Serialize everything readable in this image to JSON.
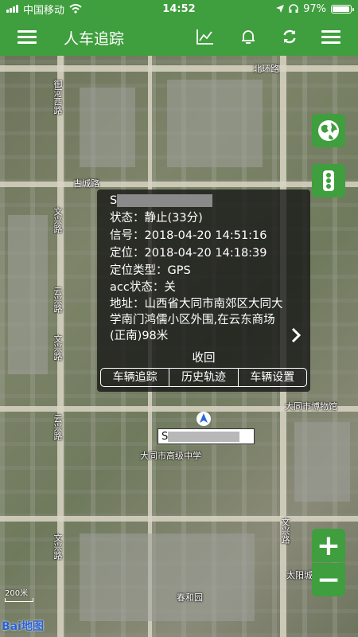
{
  "status_bar": {
    "carrier": "中国移动",
    "time": "14:52",
    "battery": "97%",
    "battery_level": 0.97
  },
  "nav": {
    "title": "人车追踪",
    "icons": [
      "menu-icon",
      "chart-icon",
      "bell-icon",
      "refresh-icon",
      "list-menu-icon"
    ]
  },
  "map": {
    "labels": {
      "road_top": "北环路",
      "road_left_1": "御河西路",
      "road_left_2": "文兴路",
      "road_left_3": "云兴路",
      "road_left_4": "文兴路",
      "road_left_5": "云兴路",
      "road_left_6": "文兴路",
      "road_mid": "古城路",
      "museum": "大同市博物馆",
      "school": "大同市高级中学",
      "park": "春和园",
      "right_road": "文兴路",
      "bottom_right": "太阳城"
    },
    "scale": "200米",
    "logo": "Bai地图"
  },
  "popup": {
    "plate_prefix": "S",
    "status_label": "状态：",
    "status_value": "静止(33分)",
    "signal_label": "信号：",
    "signal_value": "2018-04-20 14:51:16",
    "locate_label": "定位：",
    "locate_value": "2018-04-20 14:18:39",
    "locate_type_label": "定位类型：",
    "locate_type_value": "GPS",
    "acc_label": "acc状态：",
    "acc_value": "关",
    "address_label": "地址：",
    "address_value": "山西省大同市南郊区大同大学南门鸿儒小区外围,在云东商场(正南)98米",
    "collapse": "收回",
    "actions": [
      "车辆追踪",
      "历史轨迹",
      "车辆设置"
    ]
  },
  "marker": {
    "plate_prefix": "S"
  },
  "zoom": {
    "in": "+",
    "out": "−"
  },
  "colors": {
    "primary": "#3f9e3d",
    "popup_bg": "rgba(20,20,20,0.78)"
  }
}
